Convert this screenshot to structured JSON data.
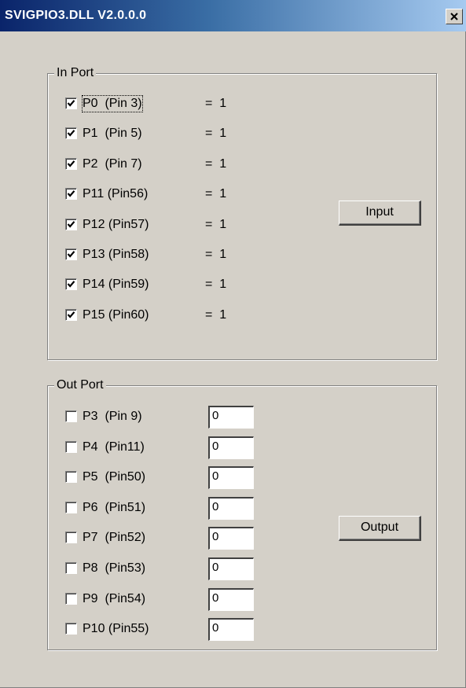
{
  "window": {
    "title": "SVIGPIO3.DLL  V2.0.0.0",
    "close_label": "×"
  },
  "in_port": {
    "label": "In Port",
    "button_label": "Input",
    "rows": [
      {
        "label": "P0  (Pin 3)",
        "value": "=  1",
        "checked": true
      },
      {
        "label": "P1  (Pin 5)",
        "value": "=  1",
        "checked": true
      },
      {
        "label": "P2  (Pin 7)",
        "value": "=  1",
        "checked": true
      },
      {
        "label": "P11 (Pin56)",
        "value": "=  1",
        "checked": true
      },
      {
        "label": "P12 (Pin57)",
        "value": "=  1",
        "checked": true
      },
      {
        "label": "P13 (Pin58)",
        "value": "=  1",
        "checked": true
      },
      {
        "label": "P14 (Pin59)",
        "value": "=  1",
        "checked": true
      },
      {
        "label": "P15 (Pin60)",
        "value": "=  1",
        "checked": true
      }
    ]
  },
  "out_port": {
    "label": "Out Port",
    "button_label": "Output",
    "rows": [
      {
        "label": "P3  (Pin 9)",
        "value": "0",
        "checked": false
      },
      {
        "label": "P4  (Pin11)",
        "value": "0",
        "checked": false
      },
      {
        "label": "P5  (Pin50)",
        "value": "0",
        "checked": false
      },
      {
        "label": "P6  (Pin51)",
        "value": "0",
        "checked": false
      },
      {
        "label": "P7  (Pin52)",
        "value": "0",
        "checked": false
      },
      {
        "label": "P8  (Pin53)",
        "value": "0",
        "checked": false
      },
      {
        "label": "P9  (Pin54)",
        "value": "0",
        "checked": false
      },
      {
        "label": "P10 (Pin55)",
        "value": "0",
        "checked": false
      }
    ]
  }
}
